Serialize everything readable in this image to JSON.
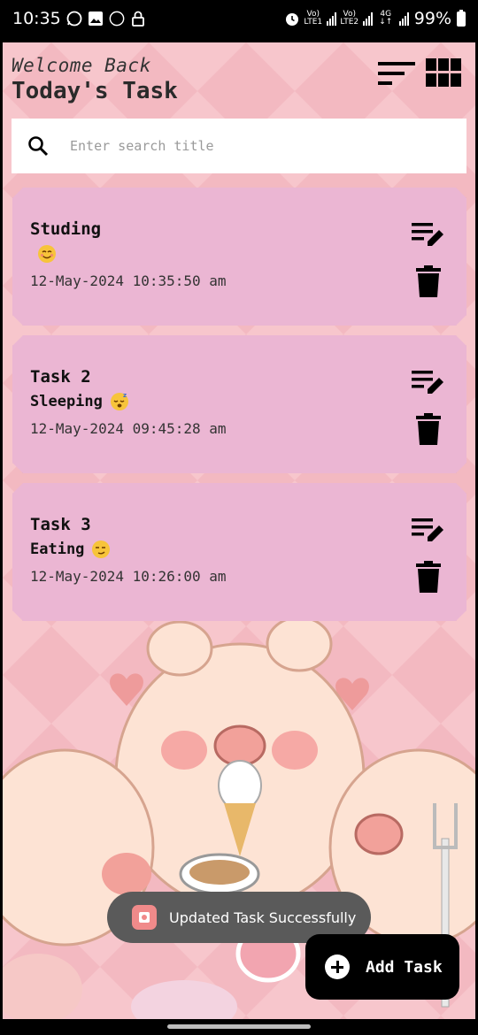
{
  "status_bar": {
    "time": "10:35",
    "notif_badge": "99",
    "net1": "VoLTE1",
    "net2": "VoLTE2",
    "net_type": "4G",
    "battery": "99%"
  },
  "header": {
    "welcome": "Welcome Back",
    "title": "Today's Task"
  },
  "search": {
    "placeholder": "Enter search title",
    "value": ""
  },
  "tasks": [
    {
      "title": "Studing",
      "description": "",
      "emoji": "smiling-face",
      "date": "12-May-2024 10:35:50 am"
    },
    {
      "title": "Task 2",
      "description": "Sleeping",
      "emoji": "sleeping-face",
      "date": "12-May-2024 09:45:28 am"
    },
    {
      "title": "Task 3",
      "description": "Eating",
      "emoji": "smirking-face",
      "date": "12-May-2024 10:26:00 am"
    }
  ],
  "toast": {
    "message": "Updated Task Successfully"
  },
  "fab": {
    "label": "Add Task"
  },
  "colors": {
    "background": "#f7c6cc",
    "card": "#ebb6d3",
    "fab": "#000000",
    "toast": "#5a5a5a"
  }
}
